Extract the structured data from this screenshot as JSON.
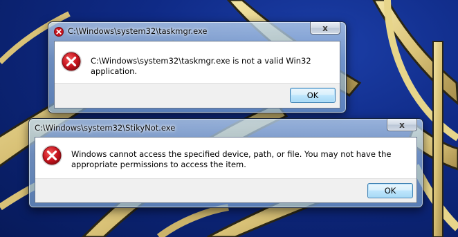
{
  "desktop": {
    "wallpaper_colors": {
      "sky": "#0f2a86",
      "structure": "#e7d58a",
      "shadow": "#2a2616"
    }
  },
  "dialogs": [
    {
      "title": "C:\\Windows\\system32\\taskmgr.exe",
      "title_icon": "error-icon",
      "close_glyph": "x",
      "icon": "error-icon",
      "message": "C:\\Windows\\system32\\taskmgr.exe is not a valid Win32 application.",
      "ok_label": "OK"
    },
    {
      "title": "C:\\Windows\\system32\\StikyNot.exe",
      "close_glyph": "x",
      "icon": "error-icon",
      "message": "Windows cannot access the specified device, path, or file.  You may not have the appropriate permissions to access the item.",
      "ok_label": "OK"
    }
  ],
  "colors": {
    "error_red": "#c8141e",
    "ok_border": "#3c7fb1"
  }
}
